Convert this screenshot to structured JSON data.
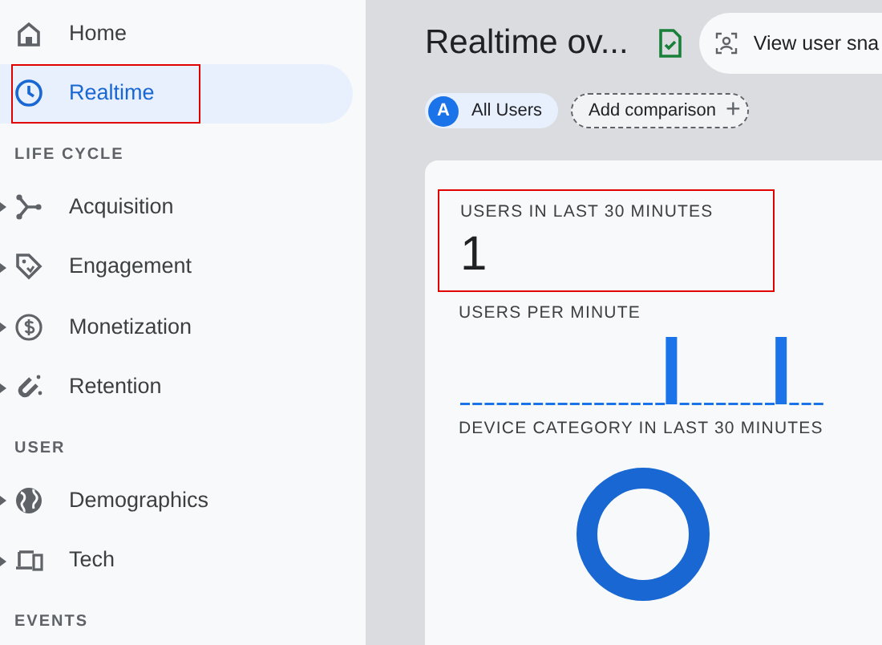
{
  "sidebar": {
    "sections": [
      {
        "items": [
          {
            "label": "Home",
            "selected": false,
            "expandable": false,
            "highlighted": false
          },
          {
            "label": "Realtime",
            "selected": true,
            "expandable": false,
            "highlighted": true
          }
        ]
      },
      {
        "heading": "LIFE CYCLE",
        "items": [
          {
            "label": "Acquisition",
            "selected": false,
            "expandable": true,
            "highlighted": false
          },
          {
            "label": "Engagement",
            "selected": false,
            "expandable": true,
            "highlighted": false
          },
          {
            "label": "Monetization",
            "selected": false,
            "expandable": true,
            "highlighted": false
          },
          {
            "label": "Retention",
            "selected": false,
            "expandable": true,
            "highlighted": false
          }
        ]
      },
      {
        "heading": "USER",
        "items": [
          {
            "label": "Demographics",
            "selected": false,
            "expandable": true,
            "highlighted": false
          },
          {
            "label": "Tech",
            "selected": false,
            "expandable": true,
            "highlighted": false
          }
        ]
      },
      {
        "heading": "EVENTS"
      }
    ]
  },
  "header": {
    "title": "Realtime ov...",
    "snapshot_button": "View user sna"
  },
  "chips": [
    {
      "kind": "segment",
      "badge": "A",
      "label": "All Users"
    },
    {
      "kind": "add",
      "label": "Add comparison",
      "symbol": "+"
    }
  ],
  "card": {
    "users_block": {
      "label": "USERS IN LAST 30 MINUTES",
      "value": "1",
      "highlighted": true
    },
    "per_minute": {
      "label": "USERS PER MINUTE"
    },
    "device": {
      "label": "DEVICE CATEGORY IN LAST 30 MINUTES"
    }
  }
}
